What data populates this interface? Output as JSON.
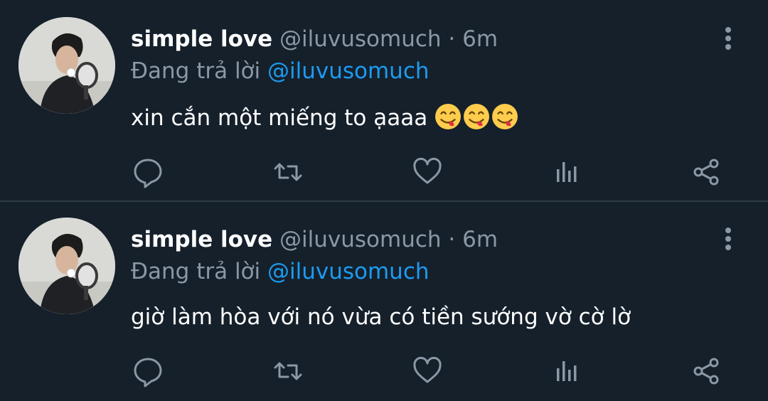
{
  "tweets": [
    {
      "display_name": "simple love",
      "handle": "@iluvusomuch",
      "separator": "·",
      "time": "6m",
      "reply_prefix": "Đang trả lời",
      "reply_to": "@iluvusomuch",
      "text": "xin cắn một miếng to ạaaa",
      "emojis": [
        "savoring-food-emoji",
        "savoring-food-emoji",
        "savoring-food-emoji"
      ]
    },
    {
      "display_name": "simple love",
      "handle": "@iluvusomuch",
      "separator": "·",
      "time": "6m",
      "reply_prefix": "Đang trả lời",
      "reply_to": "@iluvusomuch",
      "text": "giờ làm hòa với nó vừa có tiền sướng vờ cờ lờ",
      "emojis": []
    }
  ],
  "actions": [
    "reply-icon",
    "retweet-icon",
    "like-icon",
    "analytics-icon",
    "share-icon"
  ],
  "colors": {
    "background": "#15202b",
    "divider": "#2f3b47",
    "secondary_text": "#8b98a5",
    "mention": "#1d9bf0",
    "icon": "#8b98a5"
  }
}
